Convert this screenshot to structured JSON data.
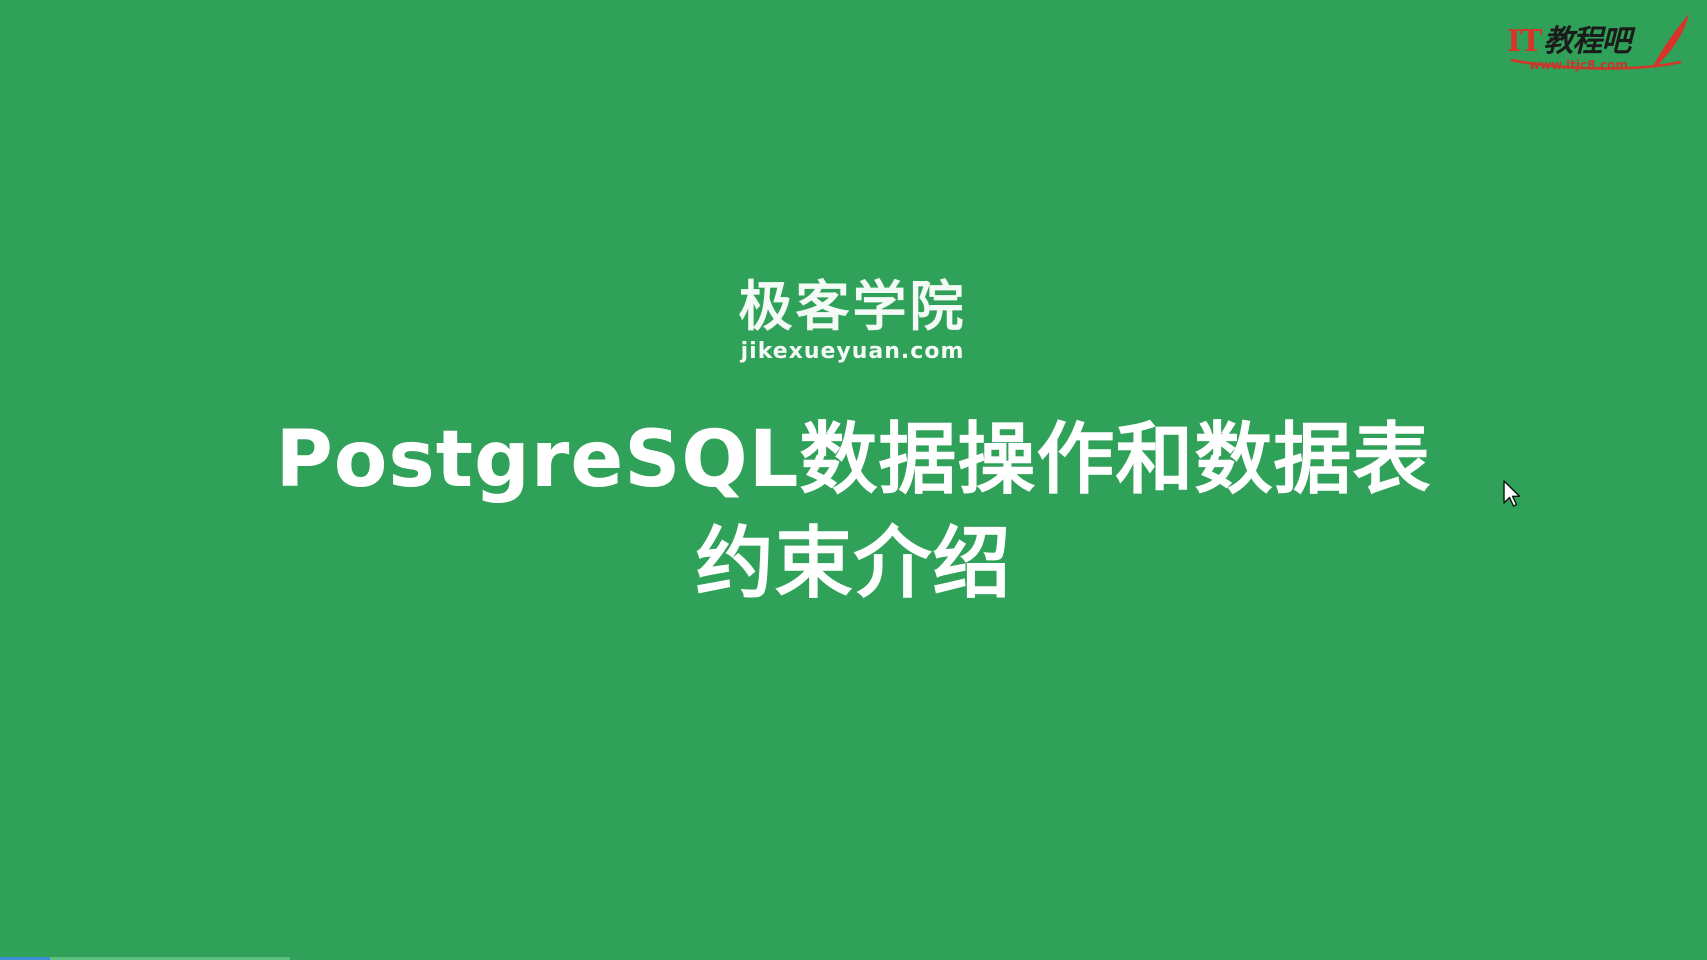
{
  "watermark": {
    "prefix": "IT",
    "brand": "教程吧",
    "url": "www.itjc8.com"
  },
  "logo": {
    "name_cn": "极客学院",
    "name_en": "jikexueyuan.com"
  },
  "slide": {
    "title_line1": "PostgreSQL数据操作和数据表",
    "title_line2": "约束介绍"
  },
  "colors": {
    "background": "#2fa158",
    "text": "#ffffff",
    "watermark_red": "#d8342a"
  },
  "icons": {
    "cursor": "mouse-pointer-icon",
    "quill": "quill-pen-icon"
  }
}
